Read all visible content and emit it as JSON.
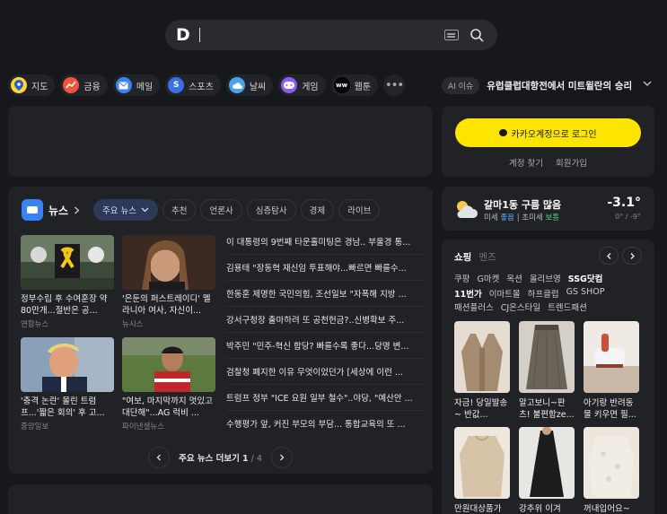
{
  "search": {
    "logo": "D",
    "placeholder": ""
  },
  "quick_links": [
    {
      "label": "지도",
      "icon": "map-pin-icon",
      "color": "#2a5bd7"
    },
    {
      "label": "금융",
      "icon": "finance-chart-icon",
      "color": "#f0553b"
    },
    {
      "label": "메일",
      "icon": "mail-icon",
      "color": "#3b82f6"
    },
    {
      "label": "스포츠",
      "icon": "sports-icon",
      "color": "#3b6ee8"
    },
    {
      "label": "날씨",
      "icon": "weather-cloud-icon",
      "color": "#4aa3f0"
    },
    {
      "label": "게임",
      "icon": "game-controller-icon",
      "color": "#8b5cf6"
    },
    {
      "label": "웹툰",
      "icon": "webtoon-icon",
      "color": "#111111"
    }
  ],
  "issue": {
    "badge": "AI 이슈",
    "text": "유럽클럽대항전에서 미트윌란의 승리"
  },
  "login": {
    "button": "카카오계정으로 로그인",
    "find": "계정 찾기",
    "signup": "회원가입"
  },
  "news": {
    "title": "뉴스",
    "tabs": [
      "주요 뉴스",
      "추천",
      "언론사",
      "심층탐사",
      "경제",
      "라이브"
    ],
    "thumbs": [
      {
        "caption": "정부수립 후 수여훈장 약 80만개...절반은 공...",
        "source": "연합뉴스"
      },
      {
        "caption": "'은둔의 퍼스트레이디' 멜라니아 여사, 자신이...",
        "source": "뉴시스"
      },
      {
        "caption": "'충격 논란' 몰린 트럼프...'짧은 회의' 후 고...",
        "source": "중앙일보"
      },
      {
        "caption": "\"여보, 마지막까지 멋있고 대단해\"...AG 럭비 ...",
        "source": "파이낸셜뉴스"
      }
    ],
    "headlines": [
      "이 대통령의 9번째 타운홀미팅은 경남.. 부울경 통...",
      "김용태 \"장동혁 재신임 투표해야...빠르면 빠를수...",
      "한동훈 제명한 국민의힘, 조선일보 \"자폭해 지방 ...",
      "강서구청장 출마하려 또 공천헌금?..신병확보 주...",
      "박주민 \"민주-혁신 합당? 빠를수록 좋다...당명 변...",
      "검찰청 폐지한 이유 무엇이었던가 [세상에 이런 ...",
      "트럼프 정부 \"ICE 요원 일부 철수\"..야당, \"예산안 ...",
      "수행평가 앞, 커진 부모의 부담... 통합교육의 또 ..."
    ],
    "pager": {
      "label": "주요 뉴스 더보기",
      "current": "1",
      "total": "4"
    }
  },
  "weather": {
    "title": "갈마1동 구름 많음",
    "dust_label": "미세",
    "dust_value": "좋음",
    "fine_dust_label": "초미세",
    "fine_dust_value": "보통",
    "temp": "-3.1°",
    "range": "0° / -9°"
  },
  "shopping": {
    "tab_on": "쇼핑",
    "tab_off": "멘즈",
    "malls_row1": [
      "쿠팡",
      "G마켓",
      "옥션",
      "올리브영",
      "SSG닷컴"
    ],
    "malls_row2": [
      "11번가",
      "이마트몰",
      "하프클럽",
      "GS SHOP"
    ],
    "malls_row3": [
      "패션플러스",
      "CJ온스타일",
      "트렌드패션"
    ],
    "products": [
      {
        "caption": "자금! 당일발송~ 반값..."
      },
      {
        "caption": "알고보니~판츠! 불편함ze..."
      },
      {
        "caption": "아기랑 반려동물 키우면 필..."
      },
      {
        "caption": "만원대상품가"
      },
      {
        "caption": "강추위 이겨"
      },
      {
        "caption": "꺼내입어요~"
      }
    ]
  }
}
